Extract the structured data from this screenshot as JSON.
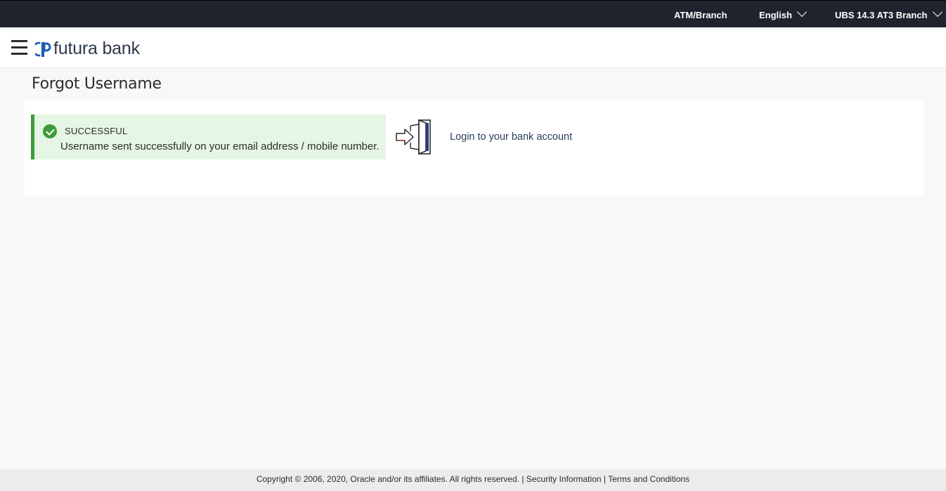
{
  "topbar": {
    "atm_branch": "ATM/Branch",
    "language": "English",
    "branch": "UBS 14.3 AT3 Branch"
  },
  "header": {
    "menu_icon": "hamburger-icon",
    "logo_text": "futura bank"
  },
  "page": {
    "title": "Forgot Username"
  },
  "alert": {
    "icon": "check-circle-icon",
    "status": "SUCCESSFUL",
    "message": "Username sent successfully on your email address / mobile number.",
    "color": "#3b9c3a",
    "background": "#e5f6e4"
  },
  "login": {
    "icon": "login-door-icon",
    "link_text": "Login to your bank account"
  },
  "footer": {
    "copyright": "Copyright © 2006, 2020, Oracle and/or its affiliates. All rights reserved.",
    "separator": "|",
    "security_link": "Security Information",
    "terms_link": "Terms and Conditions"
  },
  "colors": {
    "topbar_bg": "#1e232d",
    "page_bg": "#f8f8f8",
    "footer_bg": "#ececec"
  }
}
